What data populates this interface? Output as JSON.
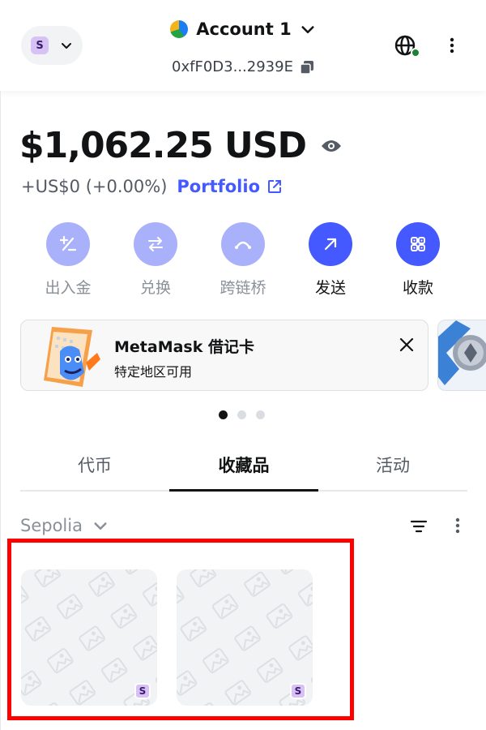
{
  "header": {
    "network_avatar_letter": "S",
    "account_name": "Account 1",
    "address": "0xfF0D3...2939E"
  },
  "balance": {
    "value": "$1,062.25 USD",
    "change": "+US$0 (+0.00%)",
    "portfolio_label": "Portfolio"
  },
  "actions": [
    {
      "label": "出入金",
      "icon": "plus-minus-icon"
    },
    {
      "label": "兑换",
      "icon": "swap-arrows-icon"
    },
    {
      "label": "跨链桥",
      "icon": "bridge-icon"
    },
    {
      "label": "发送",
      "icon": "arrow-up-right-icon"
    },
    {
      "label": "收款",
      "icon": "qr-receive-icon"
    }
  ],
  "promo": {
    "title": "MetaMask 借记卡",
    "subtitle": "特定地区可用"
  },
  "carousel": {
    "active_index": 0,
    "count": 3
  },
  "tabs": [
    {
      "label": "代币"
    },
    {
      "label": "收藏品"
    },
    {
      "label": "活动"
    }
  ],
  "active_tab": 1,
  "filter": {
    "network": "Sepolia"
  },
  "nfts": [
    {
      "badge": "S"
    },
    {
      "badge": "S"
    }
  ],
  "colors": {
    "accent": "#4459ff",
    "accent_light": "#a9b1fb",
    "highlight": "#ff0000",
    "online": "#1c8234"
  }
}
